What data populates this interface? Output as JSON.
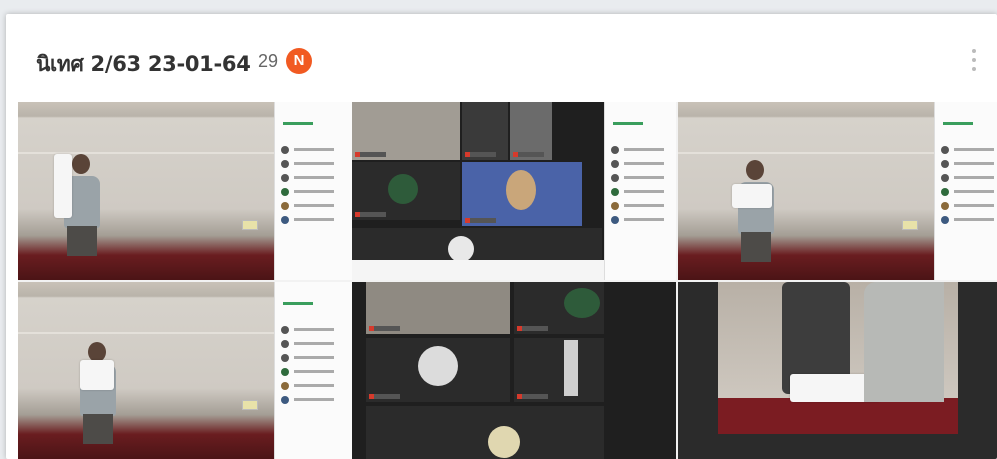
{
  "header": {
    "title": "นิเทศ 2/63 23-01-64",
    "count": "29",
    "badge": "N"
  },
  "colors": {
    "badge": "#f15a22",
    "title": "#333333",
    "card": "#ffffff"
  },
  "icons": {
    "menu": "more-vertical-icon"
  },
  "gallery": {
    "tile_count": 6,
    "tiles": [
      {
        "name": "photo-1",
        "type": "room-with-participants-panel"
      },
      {
        "name": "photo-2",
        "type": "zoom-gallery-with-panel"
      },
      {
        "name": "photo-3",
        "type": "room-with-participants-panel"
      },
      {
        "name": "photo-4",
        "type": "room-with-participants-panel"
      },
      {
        "name": "photo-5",
        "type": "zoom-gallery"
      },
      {
        "name": "photo-6",
        "type": "room-closeup"
      }
    ]
  }
}
